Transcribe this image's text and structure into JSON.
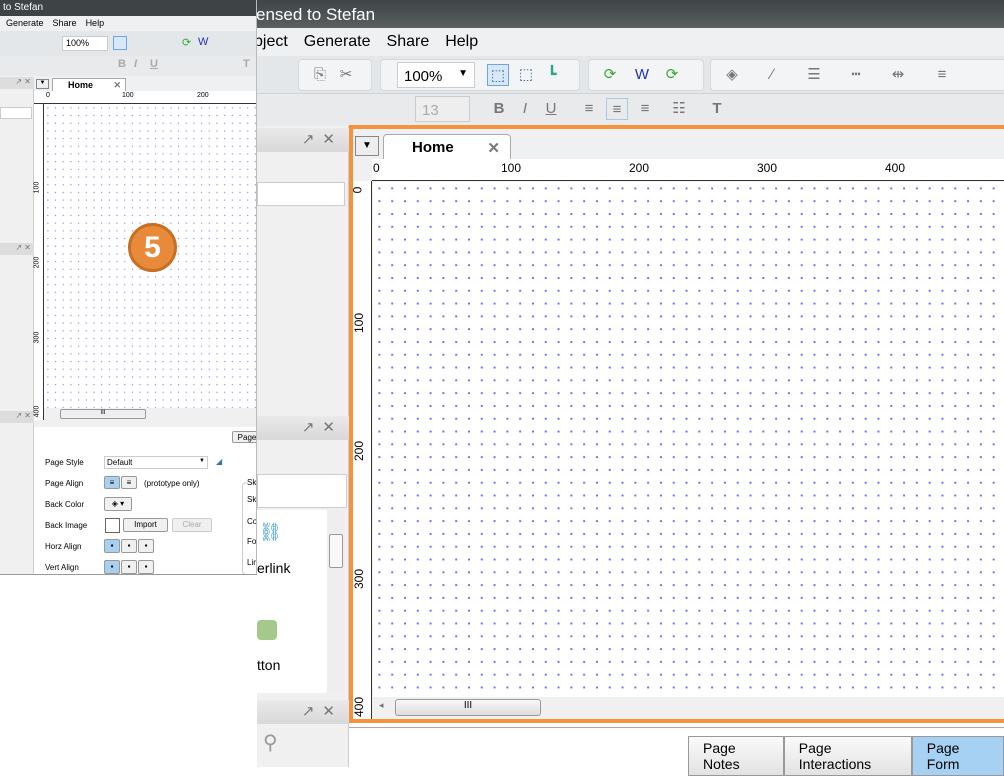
{
  "main_window": {
    "title": "ensed to Stefan",
    "menu": [
      "bject",
      "Generate",
      "Share",
      "Help"
    ],
    "zoom": "100%",
    "font_size": "13",
    "canvas_tab": "Home",
    "ruler_top": [
      "0",
      "100",
      "200",
      "300",
      "400"
    ],
    "ruler_left": [
      "0",
      "100",
      "200",
      "300",
      "400"
    ],
    "widget_labels": [
      "erlink",
      "tton"
    ],
    "bottom_tabs": [
      "Page Notes",
      "Page Interactions",
      "Page Form"
    ],
    "highlight_color": "#f5923e"
  },
  "inset_window": {
    "title": "to Stefan",
    "menu": [
      "Generate",
      "Share",
      "Help"
    ],
    "zoom": "100%",
    "canvas_tab": "Home",
    "ruler_top": [
      "0",
      "100",
      "200"
    ],
    "ruler_left": [
      "100",
      "200",
      "300",
      "400"
    ],
    "page_tab": "Page",
    "props": {
      "page_style_label": "Page Style",
      "page_style_value": "Default",
      "page_align_label": "Page Align",
      "page_align_note": "(prototype only)",
      "back_color_label": "Back Color",
      "back_image_label": "Back Image",
      "import": "Import",
      "clear": "Clear",
      "horz_align_label": "Horz Align",
      "vert_align_label": "Vert Align",
      "sketch_labels": [
        "Sk",
        "Sk",
        "Co",
        "Fo",
        "Lin"
      ]
    }
  },
  "step_badge": "5"
}
